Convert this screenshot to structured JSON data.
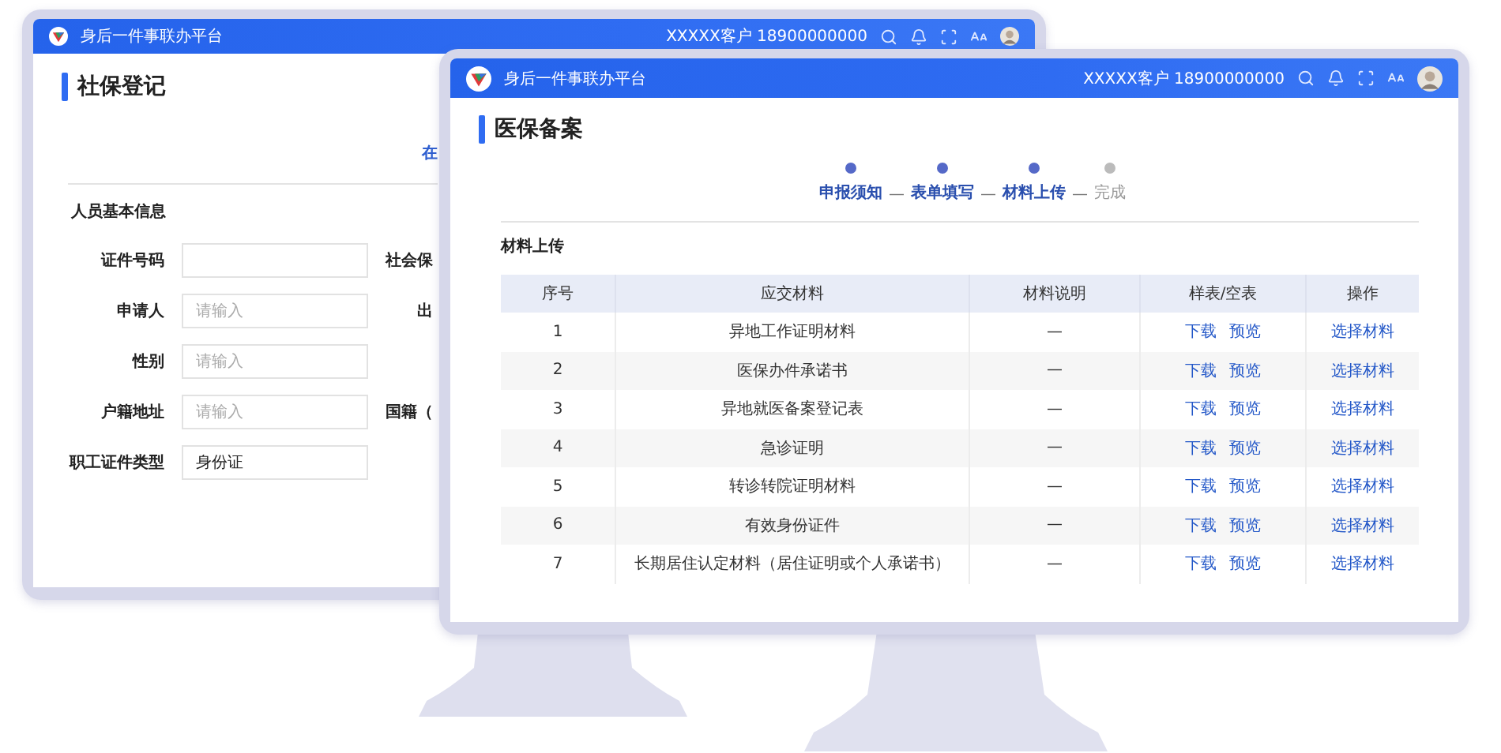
{
  "back_window": {
    "header": {
      "title": "身后一件事联办平台",
      "user": "XXXXX客户 18900000000"
    },
    "page_title": "社保登记",
    "link": "在",
    "section_title": "人员基本信息",
    "fields": [
      {
        "label": "证件号码",
        "side_label": "社会保"
      },
      {
        "label": "申请人",
        "placeholder": "请输入",
        "side_label": "出"
      },
      {
        "label": "性别",
        "placeholder": "请输入"
      },
      {
        "label": "户籍地址",
        "placeholder": "请输入",
        "side_label": "国籍（"
      },
      {
        "label": "职工证件类型",
        "value": "身份证"
      }
    ]
  },
  "front_window": {
    "header": {
      "title": "身后一件事联办平台",
      "user": "XXXXX客户 18900000000"
    },
    "page_title": "医保备案",
    "steps": [
      {
        "label": "申报须知",
        "done": true,
        "separator": "—"
      },
      {
        "label": "表单填写",
        "done": true,
        "separator": "—"
      },
      {
        "label": "材料上传",
        "done": true,
        "separator": "—"
      },
      {
        "label": "完成",
        "done": false
      }
    ],
    "section_title": "材料上传",
    "table": {
      "columns": [
        "序号",
        "应交材料",
        "材料说明",
        "样表/空表",
        "操作"
      ],
      "rows": [
        {
          "no": "1",
          "material": "异地工作证明材料",
          "note": "—",
          "links": [
            "下载",
            "预览"
          ],
          "action": "选择材料"
        },
        {
          "no": "2",
          "material": "医保办件承诺书",
          "note": "—",
          "links": [
            "下载",
            "预览"
          ],
          "action": "选择材料"
        },
        {
          "no": "3",
          "material": "异地就医备案登记表",
          "note": "—",
          "links": [
            "下载",
            "预览"
          ],
          "action": "选择材料"
        },
        {
          "no": "4",
          "material": "急诊证明",
          "note": "—",
          "links": [
            "下载",
            "预览"
          ],
          "action": "选择材料"
        },
        {
          "no": "5",
          "material": "转诊转院证明材料",
          "note": "—",
          "links": [
            "下载",
            "预览"
          ],
          "action": "选择材料"
        },
        {
          "no": "6",
          "material": "有效身份证件",
          "note": "—",
          "links": [
            "下载",
            "预览"
          ],
          "action": "选择材料"
        },
        {
          "no": "7",
          "material": "长期居住认定材料（居住证明或个人承诺书）",
          "note": "—",
          "links": [
            "下载",
            "预览"
          ],
          "action": "选择材料"
        }
      ]
    }
  }
}
